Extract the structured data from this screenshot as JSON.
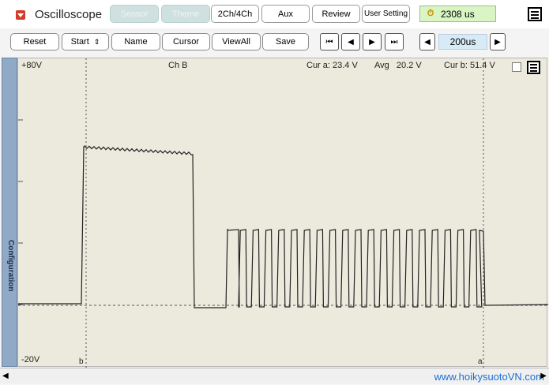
{
  "app": {
    "title": "Oscilloscope"
  },
  "tabs": [
    {
      "label": "Sensor",
      "enabled": false
    },
    {
      "label": "Theme",
      "enabled": false
    },
    {
      "label": "2Ch/4Ch",
      "enabled": true
    },
    {
      "label": "Aux",
      "enabled": true
    },
    {
      "label": "Review",
      "enabled": true
    },
    {
      "label": "User Setting",
      "enabled": true
    }
  ],
  "time_display": {
    "value": "2308 us",
    "icon": "trigger-timer-icon",
    "color": "#d9f5c4"
  },
  "toolbar": {
    "reset": "Reset",
    "start": "Start",
    "name": "Name",
    "cursor": "Cursor",
    "viewall": "ViewAll",
    "save": "Save"
  },
  "navigation": {
    "first": "first-icon",
    "prev": "prev-icon",
    "next": "next-icon",
    "last": "last-icon"
  },
  "timebase": {
    "value": "200us"
  },
  "sidepanel": {
    "label": "Configuration"
  },
  "scope": {
    "top_voltage": "+80V",
    "bottom_voltage": "-20V",
    "channel": "Ch B",
    "cur_a": "Cur a: 23.4 V",
    "avg": "Avg   20.2 V",
    "cur_b": "Cur b: 51.4 V",
    "cursor_b_label": "b",
    "cursor_a_label": "a"
  },
  "watermark": "www.hoikysuotoVN.com",
  "colors": {
    "scope_bg": "#eceadd",
    "trace": "#222222",
    "config_panel": "#8fa9c6",
    "timebase_bg": "#d8eaf6"
  }
}
